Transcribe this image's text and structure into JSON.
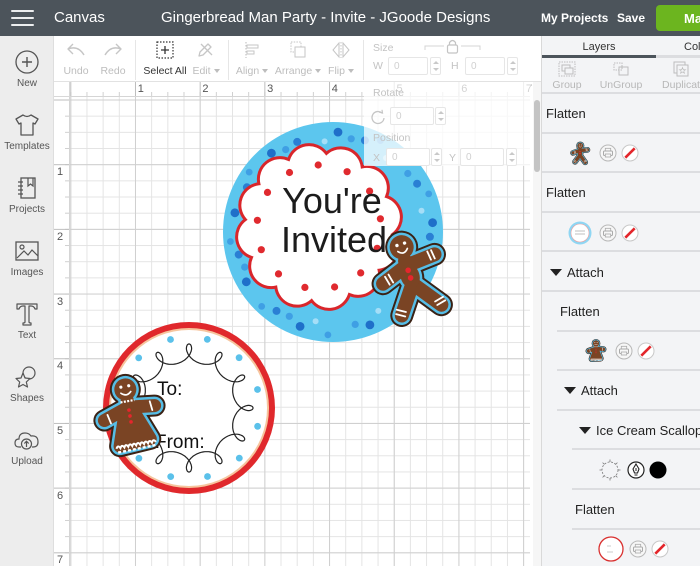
{
  "header": {
    "section": "Canvas",
    "project_title": "Gingerbread Man Party - Invite - JGoode Designs",
    "my_projects": "My Projects",
    "save": "Save",
    "make_it": "Ma"
  },
  "sidebar": {
    "items": [
      {
        "label": "New",
        "icon": "plus-circle-icon"
      },
      {
        "label": "Templates",
        "icon": "tshirt-icon"
      },
      {
        "label": "Projects",
        "icon": "notebook-icon"
      },
      {
        "label": "Images",
        "icon": "image-icon"
      },
      {
        "label": "Text",
        "icon": "text-icon"
      },
      {
        "label": "Shapes",
        "icon": "shapes-icon"
      },
      {
        "label": "Upload",
        "icon": "cloud-upload-icon"
      }
    ]
  },
  "toolbar": {
    "undo": "Undo",
    "redo": "Redo",
    "select_all": "Select All",
    "edit": "Edit",
    "align": "Align",
    "arrange": "Arrange",
    "flip": "Flip",
    "size": {
      "label": "Size",
      "w_label": "W",
      "w_value": "0",
      "h_label": "H",
      "h_value": "0"
    },
    "rotate": {
      "label": "Rotate",
      "value": "0"
    },
    "position": {
      "label": "Position",
      "x_label": "X",
      "x_value": "0",
      "y_label": "Y",
      "y_value": "0"
    }
  },
  "canvas": {
    "ruler_x": [
      "1",
      "2",
      "3",
      "4",
      "5",
      "6",
      "7"
    ],
    "ruler_y": [
      "1",
      "2",
      "3",
      "4",
      "5",
      "6",
      "7"
    ],
    "invite_sticker": {
      "line1": "You're",
      "line2": "Invited"
    },
    "gift_tag": {
      "to": "To:",
      "from": "From:"
    }
  },
  "layers_panel": {
    "tabs": [
      {
        "label": "Layers",
        "active": true
      },
      {
        "label": "Col",
        "active": false
      }
    ],
    "actions": [
      {
        "label": "Group",
        "enabled": false
      },
      {
        "label": "UnGroup",
        "enabled": false
      },
      {
        "label": "Duplicat",
        "enabled": false
      }
    ],
    "rows": [
      {
        "kind": "group",
        "label": "Flatten",
        "level": 0
      },
      {
        "kind": "layer",
        "thumbnail": "gingerbread-man",
        "operation": "print",
        "level": 0
      },
      {
        "kind": "group",
        "label": "Flatten",
        "level": 0
      },
      {
        "kind": "layer",
        "thumbnail": "youre-invited-sticker",
        "operation": "print",
        "level": 0
      },
      {
        "kind": "group",
        "label": "Attach",
        "level": 0,
        "expanded": true
      },
      {
        "kind": "group",
        "label": "Flatten",
        "level": 1
      },
      {
        "kind": "layer",
        "thumbnail": "gingerbread-woman",
        "operation": "print",
        "level": 1
      },
      {
        "kind": "group",
        "label": "Attach",
        "level": 1,
        "expanded": true
      },
      {
        "kind": "group",
        "label": "Ice Cream Scallop",
        "level": 2,
        "expanded": true
      },
      {
        "kind": "layer",
        "thumbnail": "scallop-outline",
        "operation": "draw",
        "color": "#000000",
        "level": 2
      },
      {
        "kind": "group",
        "label": "Flatten",
        "level": 2
      },
      {
        "kind": "layer",
        "thumbnail": "to-from-tag",
        "operation": "print",
        "level": 2
      }
    ]
  },
  "colors": {
    "header_bg": "#4c545b",
    "make_it_button": "#6cb51f",
    "sticker_blue": "#5cc6ee",
    "sticker_red": "#e0282e",
    "gingerbread_brown": "#7a4424",
    "icing_blue": "#56bde6"
  }
}
